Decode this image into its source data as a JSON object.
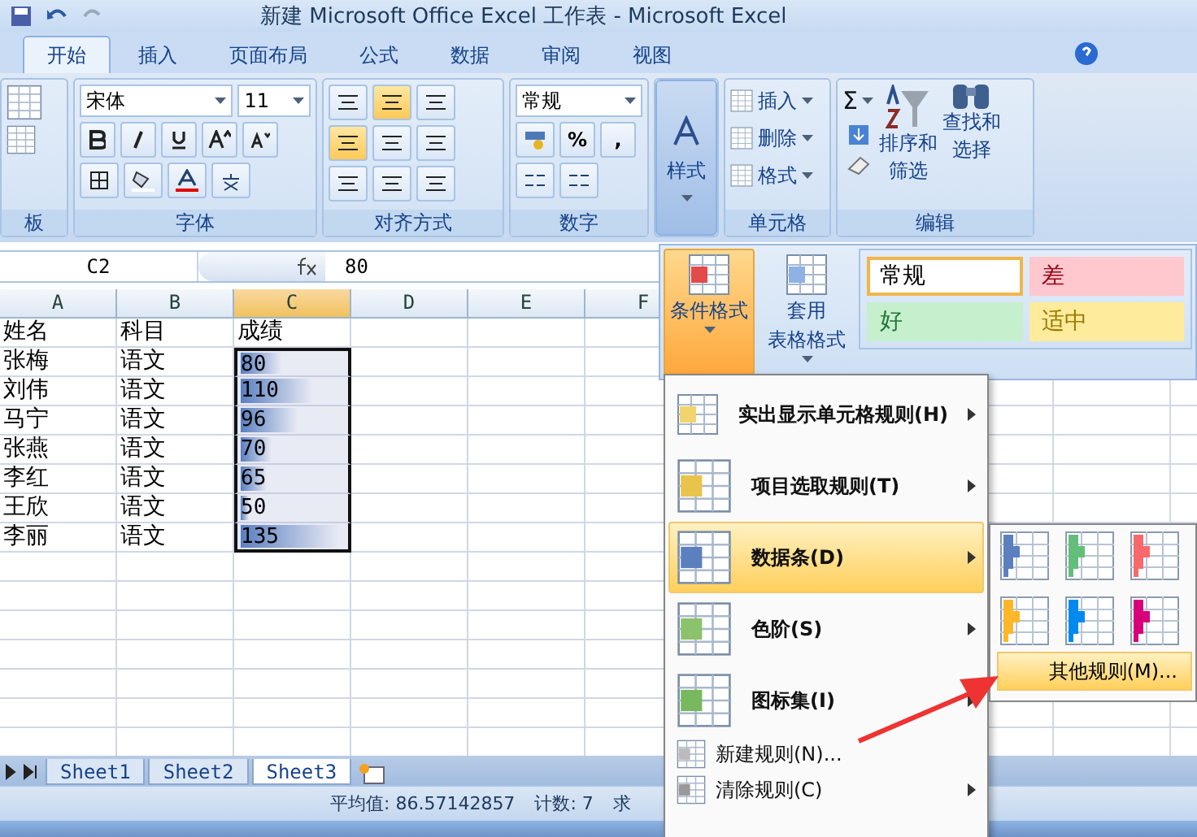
{
  "window": {
    "title": "新建 Microsoft Office Excel 工作表 - Microsoft Excel"
  },
  "tabs": [
    {
      "label": "开始",
      "selected": true
    },
    {
      "label": "插入",
      "selected": false
    },
    {
      "label": "页面布局",
      "selected": false
    },
    {
      "label": "公式",
      "selected": false
    },
    {
      "label": "数据",
      "selected": false
    },
    {
      "label": "审阅",
      "selected": false
    },
    {
      "label": "视图",
      "selected": false
    }
  ],
  "ribbon": {
    "clipboard": {
      "group": "板"
    },
    "font": {
      "name": "宋体",
      "size": "11",
      "group": "字体"
    },
    "alignment": {
      "group": "对齐方式"
    },
    "number": {
      "format": "常规",
      "percent": "%",
      "comma": ",",
      "group": "数字"
    },
    "styles": {
      "label": "样式",
      "selected": true
    },
    "cells": {
      "items": [
        "插入",
        "删除",
        "格式"
      ],
      "group": "单元格"
    },
    "editing": {
      "sum": "Σ",
      "sort": [
        "排序和",
        "筛选"
      ],
      "find": [
        "查找和",
        "选择"
      ],
      "group": "编辑"
    }
  },
  "formula_bar": {
    "name": "C2",
    "value": "80"
  },
  "columns": [
    {
      "label": "A",
      "selected": false
    },
    {
      "label": "B",
      "selected": false
    },
    {
      "label": "C",
      "selected": true
    },
    {
      "label": "D",
      "selected": false
    },
    {
      "label": "E",
      "selected": false
    },
    {
      "label": "F",
      "selected": false
    }
  ],
  "header_row": [
    "姓名",
    "科目",
    "成绩"
  ],
  "rows": [
    {
      "name": "张梅",
      "subject": "语文",
      "score": "80",
      "level": 0.38
    },
    {
      "name": "刘伟",
      "subject": "语文",
      "score": "110",
      "level": 0.67
    },
    {
      "name": "马宁",
      "subject": "语文",
      "score": "96",
      "level": 0.53
    },
    {
      "name": "张燕",
      "subject": "语文",
      "score": "70",
      "level": 0.29
    },
    {
      "name": "李红",
      "subject": "语文",
      "score": "65",
      "level": 0.24
    },
    {
      "name": "王欣",
      "subject": "语文",
      "score": "50",
      "level": 0.08
    },
    {
      "name": "李丽",
      "subject": "语文",
      "score": "135",
      "level": 0.91
    }
  ],
  "sheets": [
    {
      "label": "Sheet1",
      "selected": false
    },
    {
      "label": "Sheet2",
      "selected": false
    },
    {
      "label": "Sheet3",
      "selected": true
    }
  ],
  "status_bar": [
    "平均值: 86.57142857",
    "计数: 7",
    "求"
  ],
  "styles_panel": {
    "buttons": [
      {
        "label": [
          "条件格式"
        ],
        "selected": true
      },
      {
        "label": [
          "套用",
          "表格格式"
        ],
        "selected": false
      }
    ],
    "gallery": [
      {
        "label": "常规",
        "color": "#ffffff",
        "selected": true
      },
      {
        "label": "差",
        "color": "#ffc7ce",
        "selected": false
      },
      {
        "label": "好",
        "color": "#c6efce",
        "selected": false
      },
      {
        "label": "适中",
        "color": "#ffeb9c",
        "selected": false
      }
    ]
  },
  "menu": [
    {
      "kind": "large",
      "label": "实出显示单元格规则(H)",
      "submenu": true,
      "selected": false
    },
    {
      "kind": "large",
      "label": "项目选取规则(T)",
      "submenu": true,
      "selected": false
    },
    {
      "kind": "large",
      "label": "数据条(D)",
      "submenu": true,
      "selected": true
    },
    {
      "kind": "large",
      "label": "色阶(S)",
      "submenu": true,
      "selected": false
    },
    {
      "kind": "large",
      "label": "图标集(I)",
      "submenu": true,
      "selected": false
    },
    {
      "kind": "small",
      "label": "新建规则(N)...",
      "submenu": false,
      "selected": false
    },
    {
      "kind": "small",
      "label": "清除规则(C)",
      "submenu": true,
      "selected": false
    }
  ],
  "submenu": {
    "bars": [
      {
        "color": "#5b7fbf"
      },
      {
        "color": "#63be7b"
      },
      {
        "color": "#f8696b"
      },
      {
        "color": "#ffb628"
      },
      {
        "color": "#008aef"
      },
      {
        "color": "#d6007b"
      }
    ],
    "more": {
      "label": "其他规则(M)...",
      "selected": true
    }
  }
}
